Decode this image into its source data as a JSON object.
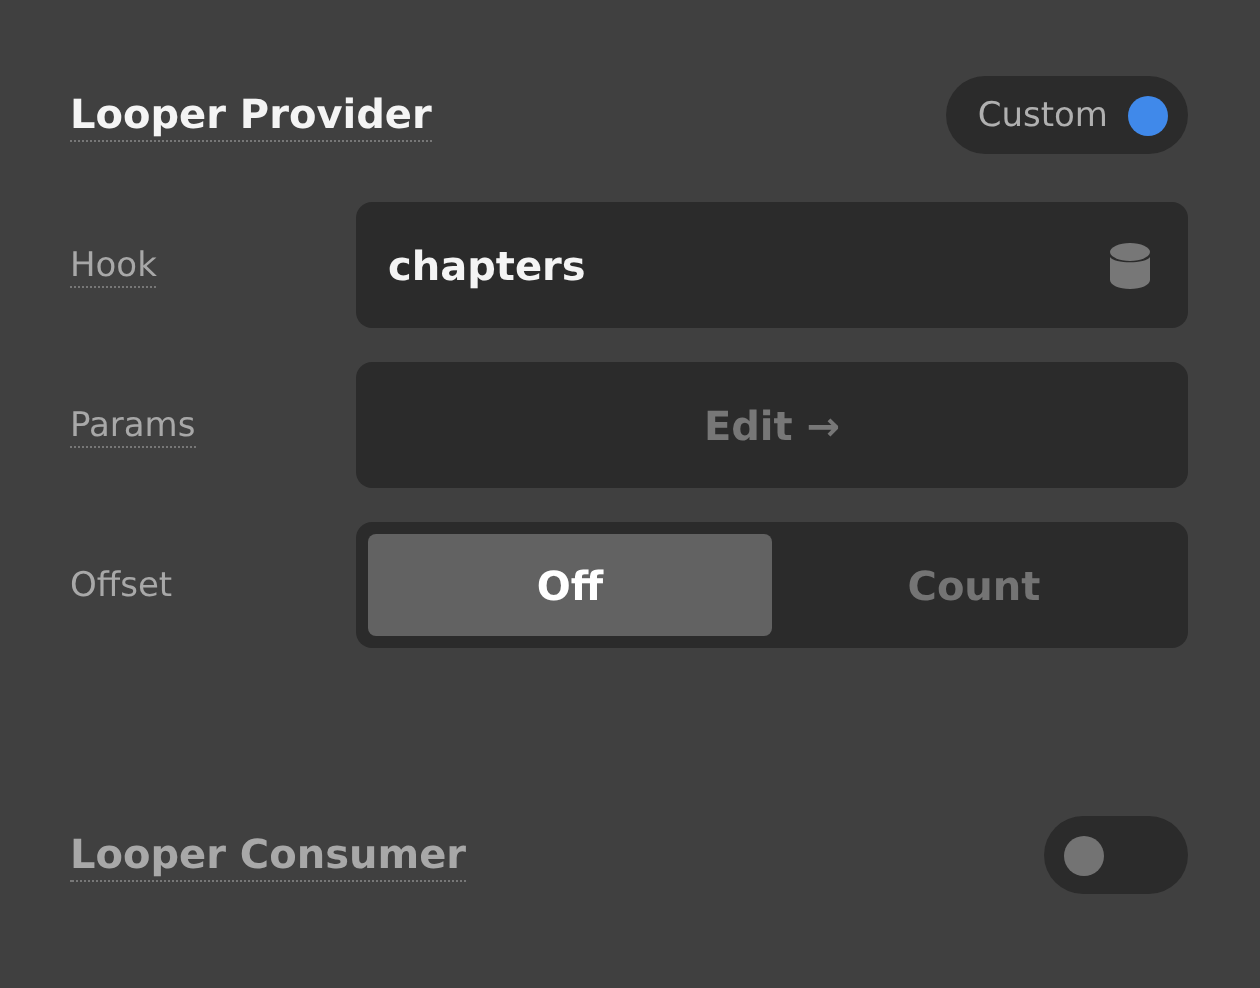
{
  "provider": {
    "title": "Looper Provider",
    "toggle": {
      "kind": "pill",
      "label": "Custom",
      "on": true
    }
  },
  "rows": [
    {
      "kind": "field",
      "label": "Hook",
      "value": "chapters"
    },
    {
      "kind": "button",
      "label": "Params",
      "value": "Edit →"
    },
    {
      "kind": "segmented",
      "label": "Offset",
      "options": [
        {
          "label": "Off",
          "selected": true
        },
        {
          "label": "Count",
          "selected": false
        }
      ]
    }
  ],
  "consumer": {
    "title": "Looper Consumer",
    "toggle": {
      "kind": "switch",
      "on": false
    }
  }
}
